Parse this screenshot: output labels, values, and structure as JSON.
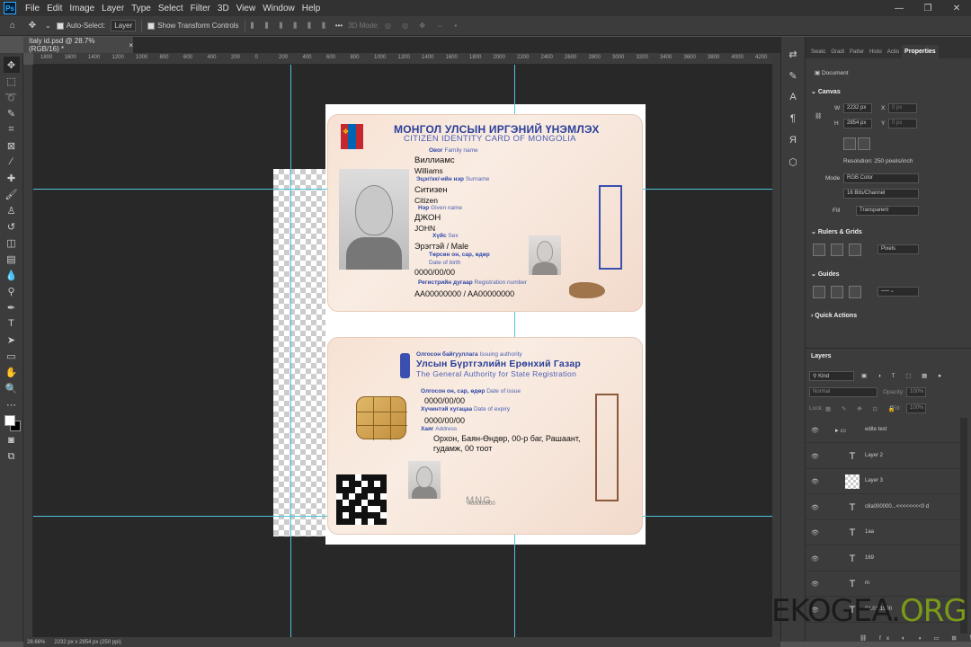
{
  "menubar": {
    "items": [
      "File",
      "Edit",
      "Image",
      "Layer",
      "Type",
      "Select",
      "Filter",
      "3D",
      "View",
      "Window",
      "Help"
    ]
  },
  "options": {
    "auto_select_label": "Auto-Select:",
    "auto_select_value": "Layer",
    "transform_label": "Show Transform Controls",
    "mode_label": "3D Mode:",
    "more": "•••"
  },
  "document": {
    "tab_title": "Italy id.psd @ 28.7% (RGB/16) *",
    "close": "×"
  },
  "ruler": {
    "ticks": [
      "1800",
      "1600",
      "1400",
      "1200",
      "1000",
      "800",
      "600",
      "400",
      "200",
      "0",
      "200",
      "400",
      "600",
      "800",
      "1000",
      "1200",
      "1400",
      "1600",
      "1800",
      "2000",
      "2200",
      "2400",
      "2600",
      "2800",
      "3000",
      "3200",
      "3400",
      "3600",
      "3800",
      "4000",
      "4200"
    ]
  },
  "status": {
    "zoom": "28.66%",
    "info": "2232 px x 2854 px (250 ppi)"
  },
  "card_front": {
    "title": "МОНГОЛ УЛСЫН ИРГЭНИЙ ҮНЭМЛЭХ",
    "subtitle": "CITIZEN IDENTITY CARD OF MONGOLIA",
    "family_label_mn": "Овог",
    "family_label_en": "Family name",
    "family_value_mn": "Виллиамс",
    "family_value_en": "Williams",
    "surname_label_mn": "Эцэг/эх/-ийн нэр",
    "surname_label_en": "Surname",
    "surname_value_mn": "Ситизен",
    "surname_value_en": "Citizen",
    "given_label_mn": "Нэр",
    "given_label_en": "Given name",
    "given_value_mn": "ДЖОН",
    "given_value_en": "JOHN",
    "sex_label_mn": "Хүйс",
    "sex_label_en": "Sex",
    "sex_value": "Эрэгтэй  / Male",
    "dob_label_mn": "Төрсөн он, сар, өдөр",
    "dob_label_en": "Date of birth",
    "dob_value": "0000/00/00",
    "reg_label_mn": "Регистрийн дугаар",
    "reg_label_en": "Registration number",
    "reg_value": "AA00000000    / AA00000000"
  },
  "card_back": {
    "authority_label_mn": "Олгосон байгууллага",
    "authority_label_en": "Issuing authority",
    "authority_mn": "Улсын Бүртгэлийн Ерөнхий Газар",
    "authority_en": "The General Authority for State Registration",
    "issue_label_mn": "Олгосон он, сар, өдөр",
    "issue_label_en": "Date of issue",
    "issue_value": "0000/00/00",
    "expiry_label_mn": "Хүчинтэй хугацаа",
    "expiry_label_en": "Date of expiry",
    "expiry_value": "0000/00/00",
    "address_label_mn": "Хаяг",
    "address_label_en": "Address",
    "address_value_1": "Орхон, Баян-Өндөр, 00-р баг, Рашаант,",
    "address_value_2": "гудамж, 00 тоот",
    "mrz_text": "MNG",
    "small_number": "A00000000"
  },
  "panel": {
    "tabs": [
      "Swatc",
      "Gradi",
      "Patter",
      "Histo",
      "Actio",
      "Properties"
    ],
    "document_label": "Document",
    "canvas_head": "Canvas",
    "w_label": "W",
    "w_value": "2232 px",
    "h_label": "H",
    "h_value": "2854 px",
    "x_label": "X",
    "x_value": "0 px",
    "y_label": "Y",
    "y_value": "0 px",
    "resolution": "Resolution: 250 pixels/inch",
    "mode_label": "Mode",
    "mode_value": "RGB Color",
    "bit_value": "16 Bits/Channel",
    "fill_label": "Fill",
    "fill_value": "Transparent",
    "rulers_head": "Rulers & Grids",
    "units_value": "Pixels",
    "guides_head": "Guides",
    "quick_head": "Quick Actions"
  },
  "layers": {
    "head": "Layers",
    "kind": "Kind",
    "blend": "Normal",
    "opacity_label": "Opacity:",
    "opacity_value": "100%",
    "lock_label": "Lock:",
    "fill_label": "Fill:",
    "fill_value": "100%",
    "items": [
      {
        "name": "edite text",
        "type": "folder"
      },
      {
        "name": "Layer 2",
        "type": "text"
      },
      {
        "name": "Layer 3",
        "type": "image"
      },
      {
        "name": "c8a000000...<<<<<<<<0 d",
        "type": "text"
      },
      {
        "name": "1aa",
        "type": "text"
      },
      {
        "name": "169",
        "type": "text"
      },
      {
        "name": "m",
        "type": "text"
      },
      {
        "name": "01.01.1990",
        "type": "text"
      }
    ]
  },
  "watermark": {
    "main": "EKOGEA.",
    "suffix": "ORG"
  },
  "colors": {
    "accent_blue": "#2a3f9a",
    "guide": "#4fc3d9",
    "flag_red": "#c4272f",
    "flag_blue": "#0066b3",
    "watermark_green": "#7a9a18"
  }
}
